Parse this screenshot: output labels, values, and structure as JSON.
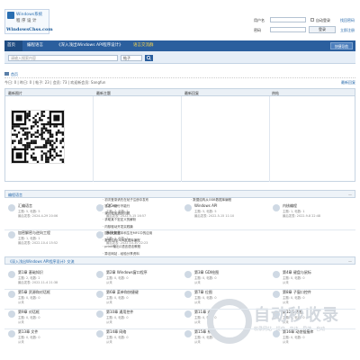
{
  "logo": {
    "line1": "Windows系统",
    "line2": "程序设计",
    "line3": "WindowsChss.com"
  },
  "login": {
    "user_label": "用户名",
    "pwd_label": "密码",
    "auto_login": "自动登录",
    "forgot": "找回密码",
    "register": "立即注册",
    "submit": "登录"
  },
  "nav": {
    "items": [
      "首页",
      "编程语言",
      "《深入浅出Windows API程序设计》",
      "语言交流群"
    ],
    "right_btn": "快捷导航"
  },
  "search": {
    "placeholder": "请输入搜索内容",
    "select": "帖子",
    "button": "搜索"
  },
  "crumb": {
    "home": "首页"
  },
  "stats": {
    "text": "今日: 0 | 昨日: 0 | 帖子: 23 | 会员: 73 | 欢迎新会员: Sangfun",
    "right": "最新回复"
  },
  "top": {
    "headers": [
      "最新图片",
      "最新主题",
      "最新回复",
      "热帖"
    ],
    "topics": [
      "关于控制台中文字符",
      "初次登录请先在帖子注册中发布",
      "宏定义能行不能行",
      "调试程序遇到问题",
      "求助某个宏定义的解析",
      "内核驱动开发实践篇",
      "国科大数据本科生在MFC中的应用",
      "数据结构ODB数据库编程",
      "printf输出C语言语法教程",
      "算法网站 - 经验分享资料",
      "算术方法 - 数据结构与算法"
    ],
    "replies": [
      "关于控制台中文字符",
      "数据结构从ODB数据库编程"
    ]
  },
  "section1": {
    "title": "编程语言",
    "forums": [
      {
        "name": "汇编语言",
        "meta": "主题: 5, 帖数: 5",
        "last": "最后发表: 2024-4-29 20:06"
      },
      {
        "name": "C/C++",
        "meta": "主题: 7, 帖数: 7",
        "last": "最后发表: 2022-5-15 16:57"
      },
      {
        "name": "Windows API",
        "meta": "主题: 5, 帖数: 5",
        "last": "最后发表: 2022-5-15 11:10"
      },
      {
        "name": "内核编程",
        "meta": "主题: 1, 帖数: 1",
        "last": "最后发表: 2022-9-8 22:48"
      },
      {
        "name": "加密解密与逆向工程",
        "meta": "主题: 1, 帖数: 1",
        "last": "最后发表: 2022-10-4 15:52"
      },
      {
        "name": "系统安全",
        "meta": "主题: 1, 帖数: 1",
        "last": "最后发表: 2022-10-30 22:23"
      }
    ]
  },
  "section2": {
    "title": "《深入浅出Windows API程序设计》交流",
    "forums": [
      {
        "name": "第1章 基础知识",
        "meta": "主题: 2, 帖数: 2",
        "last": "最后发表: 2022-11-4 21:38"
      },
      {
        "name": "第2章 Windows窗口程序",
        "meta": "主题: 0, 帖数: 0",
        "last": "从未"
      },
      {
        "name": "第3章 GDI绘图",
        "meta": "主题: 0, 帖数: 0",
        "last": "从未"
      },
      {
        "name": "第4章 键盘与鼠标",
        "meta": "主题: 0, 帖数: 0",
        "last": "从未"
      },
      {
        "name": "第5章 资源和对话框",
        "meta": "主题: 0, 帖数: 0",
        "last": "从未"
      },
      {
        "name": "第6章 菜单和快捷键",
        "meta": "主题: 0, 帖数: 0",
        "last": "从未"
      },
      {
        "name": "第7章 位图",
        "meta": "主题: 0, 帖数: 0",
        "last": "从未"
      },
      {
        "name": "第8章 子窗口控件",
        "meta": "主题: 0, 帖数: 0",
        "last": "从未"
      },
      {
        "name": "第9章 对话框",
        "meta": "主题: 0, 帖数: 0",
        "last": "从未"
      },
      {
        "name": "第10章 通用控件",
        "meta": "主题: 0, 帖数: 0",
        "last": "从未"
      },
      {
        "name": "第11章 进程",
        "meta": "主题: 0, 帖数: 0",
        "last": "从未"
      },
      {
        "name": "第12章 线程",
        "meta": "主题: 0, 帖数: 0",
        "last": "从未"
      },
      {
        "name": "第13章 文件",
        "meta": "主题: 0, 帖数: 0",
        "last": "从未"
      },
      {
        "name": "第14章 网络",
        "meta": "主题: 0, 帖数: 0",
        "last": "从未"
      },
      {
        "name": "第15章 系统",
        "meta": "主题: 0, 帖数: 0",
        "last": "从未"
      },
      {
        "name": "第16章 动态链接库",
        "meta": "主题: 0, 帖数: 0",
        "last": "从未"
      }
    ]
  },
  "watermark": {
    "big": "自动秒收录",
    "small": "收录网站 · 提交 · 来访 · 导航 · 自动"
  },
  "colors": {
    "nav": "#2b5f9e",
    "accent": "#ffd84a",
    "link": "#2266aa"
  }
}
